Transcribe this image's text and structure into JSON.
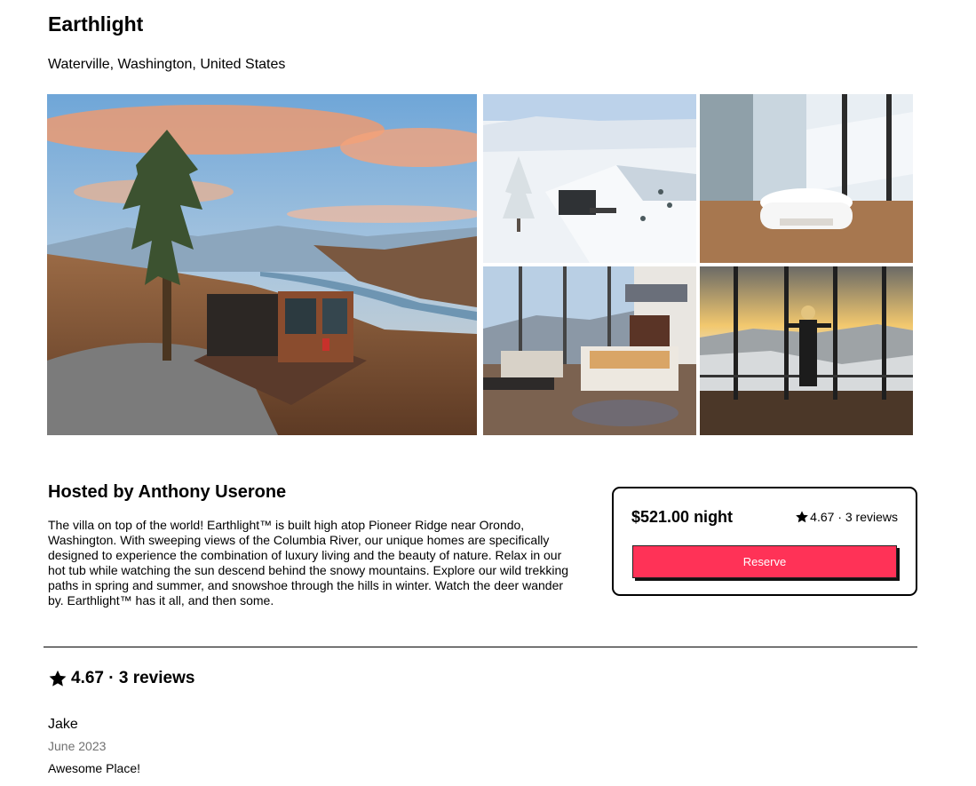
{
  "listing": {
    "title": "Earthlight",
    "location": "Waterville, Washington, United States"
  },
  "photos": [
    {
      "name": "main-photo-cabin-sunset"
    },
    {
      "name": "photo-cabin-snow"
    },
    {
      "name": "photo-bathtub"
    },
    {
      "name": "photo-bedroom"
    },
    {
      "name": "photo-window-view"
    }
  ],
  "host": {
    "title": "Hosted by Anthony Userone",
    "description": "The villa on top of the world! Earthlight™ is built high atop Pioneer Ridge near Orondo, Washington. With sweeping views of the Columbia River, our unique homes are specifically designed to experience the combination of luxury living and the beauty of nature. Relax in our hot tub while watching the sun descend behind the snowy mountains. Explore our wild trekking paths in spring and summer, and snowshoe through the hills in winter. Watch the deer wander by. Earthlight™ has it all, and then some."
  },
  "booking": {
    "price": "$521.00 night",
    "rating": "4.67",
    "reviews_text": "· 3 reviews",
    "reserve_label": "Reserve",
    "accent_color": "#ff3257"
  },
  "reviews": {
    "heading": "4.67 · 3 reviews",
    "icon": "star-icon",
    "items": [
      {
        "name": "Jake",
        "date": "June 2023",
        "text": "Awesome Place!"
      }
    ]
  }
}
